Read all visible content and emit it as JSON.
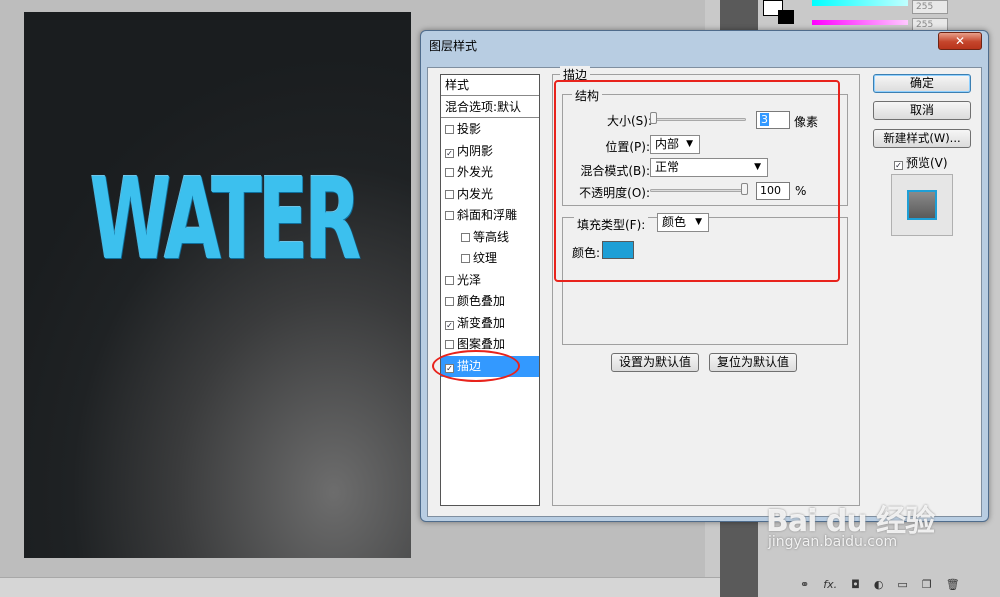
{
  "canvas": {
    "text": "WATER"
  },
  "panel": {
    "rgb_values": [
      "255",
      "255"
    ]
  },
  "dialog": {
    "title": "图层样式",
    "close_label": "✕",
    "style_list": {
      "header": "样式",
      "blend_options": "混合选项:默认",
      "items": [
        {
          "label": "投影",
          "checked": false
        },
        {
          "label": "内阴影",
          "checked": true
        },
        {
          "label": "外发光",
          "checked": false
        },
        {
          "label": "内发光",
          "checked": false
        },
        {
          "label": "斜面和浮雕",
          "checked": false
        },
        {
          "label": "等高线",
          "checked": false
        },
        {
          "label": "纹理",
          "checked": false
        },
        {
          "label": "光泽",
          "checked": false
        },
        {
          "label": "颜色叠加",
          "checked": false
        },
        {
          "label": "渐变叠加",
          "checked": true
        },
        {
          "label": "图案叠加",
          "checked": false
        },
        {
          "label": "描边",
          "checked": true,
          "selected": true
        }
      ]
    },
    "stroke": {
      "title": "描边",
      "structure": {
        "title": "结构",
        "size_label": "大小(S):",
        "size_value": "3",
        "size_unit": "像素",
        "position_label": "位置(P):",
        "position_value": "内部",
        "blend_label": "混合模式(B):",
        "blend_value": "正常",
        "opacity_label": "不透明度(O):",
        "opacity_value": "100",
        "opacity_unit": "%"
      },
      "fill": {
        "type_label": "填充类型(F):",
        "type_value": "颜色",
        "color_label": "颜色:",
        "color": "#1e9fd6"
      },
      "set_default": "设置为默认值",
      "reset_default": "复位为默认值"
    },
    "buttons": {
      "ok": "确定",
      "cancel": "取消",
      "new_style": "新建样式(W)...",
      "preview_label": "预览(V)",
      "preview_checked": true
    }
  },
  "watermark": {
    "main": "Bai du 经验",
    "sub": "jingyan.baidu.com"
  },
  "colors": {
    "annotation": "#e8231c",
    "selection": "#3399ff"
  }
}
